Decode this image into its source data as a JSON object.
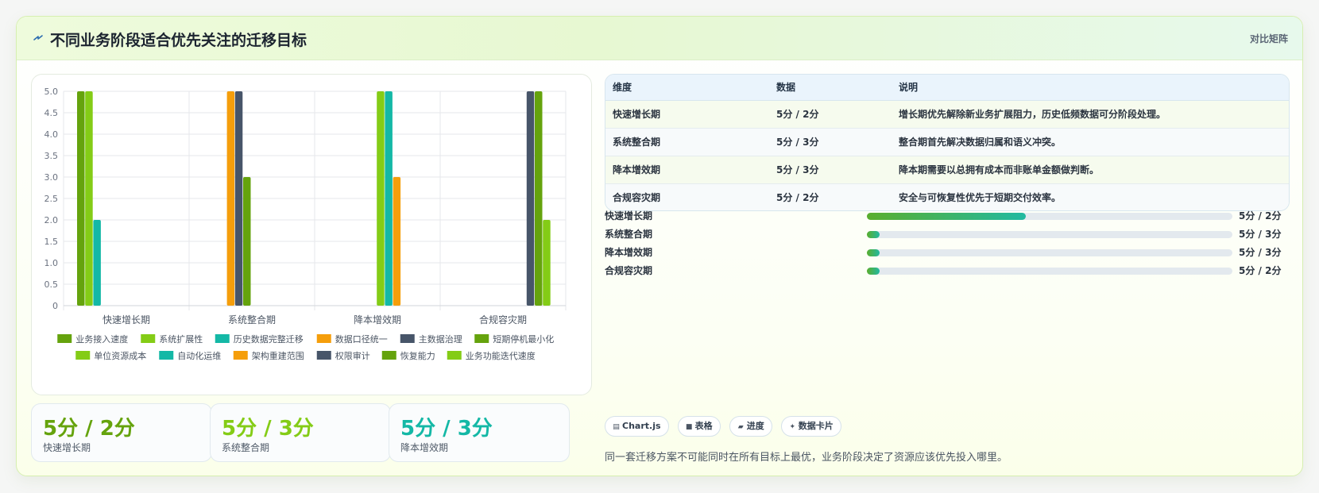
{
  "header": {
    "title": "不同业务阶段适合优先关注的迁移目标",
    "meta": "对比矩阵"
  },
  "chart_data": {
    "type": "bar",
    "categories": [
      "快速增长期",
      "系统整合期",
      "降本增效期",
      "合规容灾期"
    ],
    "ylim": [
      0,
      5
    ],
    "yticks": [
      "0",
      "0.5",
      "1.0",
      "1.5",
      "2.0",
      "2.5",
      "3.0",
      "3.5",
      "4.0",
      "4.5",
      "5.0"
    ],
    "grid": true,
    "legend_position": "bottom",
    "series": [
      {
        "name": "业务接入速度",
        "color": "#65a30d",
        "values": [
          5,
          null,
          null,
          null
        ]
      },
      {
        "name": "系统扩展性",
        "color": "#84cc16",
        "values": [
          5,
          null,
          null,
          null
        ]
      },
      {
        "name": "历史数据完整迁移",
        "color": "#14b8a6",
        "values": [
          2,
          null,
          null,
          null
        ]
      },
      {
        "name": "数据口径统一",
        "color": "#f59e0b",
        "values": [
          null,
          5,
          null,
          null
        ]
      },
      {
        "name": "主数据治理",
        "color": "#475569",
        "values": [
          null,
          5,
          null,
          null
        ]
      },
      {
        "name": "短期停机最小化",
        "color": "#65a30d",
        "values": [
          null,
          3,
          null,
          null
        ]
      },
      {
        "name": "单位资源成本",
        "color": "#84cc16",
        "values": [
          null,
          null,
          5,
          null
        ]
      },
      {
        "name": "自动化运维",
        "color": "#14b8a6",
        "values": [
          null,
          null,
          5,
          null
        ]
      },
      {
        "name": "架构重建范围",
        "color": "#f59e0b",
        "values": [
          null,
          null,
          3,
          null
        ]
      },
      {
        "name": "权限审计",
        "color": "#475569",
        "values": [
          null,
          null,
          null,
          5
        ]
      },
      {
        "name": "恢复能力",
        "color": "#65a30d",
        "values": [
          null,
          null,
          null,
          5
        ]
      },
      {
        "name": "业务功能迭代速度",
        "color": "#84cc16",
        "values": [
          null,
          null,
          null,
          2
        ]
      }
    ]
  },
  "stats": [
    {
      "value": "5分 / 2分",
      "label": "快速增长期",
      "color": "#65a30d"
    },
    {
      "value": "5分 / 3分",
      "label": "系统整合期",
      "color": "#84cc16"
    },
    {
      "value": "5分 / 3分",
      "label": "降本增效期",
      "color": "#14b8a6"
    }
  ],
  "table": {
    "headers": [
      "维度",
      "数据",
      "说明"
    ],
    "rows": [
      [
        "快速增长期",
        "5分 / 2分",
        "增长期优先解除新业务扩展阻力，历史低频数据可分阶段处理。"
      ],
      [
        "系统整合期",
        "5分 / 3分",
        "整合期首先解决数据归属和语义冲突。"
      ],
      [
        "降本增效期",
        "5分 / 3分",
        "降本期需要以总拥有成本而非账单金额做判断。"
      ],
      [
        "合规容灾期",
        "5分 / 2分",
        "安全与可恢复性优先于短期交付效率。"
      ]
    ]
  },
  "progress": [
    {
      "label": "快速增长期",
      "value": "5分 / 2分",
      "fraction": 0.435
    },
    {
      "label": "系统整合期",
      "value": "5分 / 3分",
      "fraction": 0.035
    },
    {
      "label": "降本增效期",
      "value": "5分 / 3分",
      "fraction": 0.035
    },
    {
      "label": "合规容灾期",
      "value": "5分 / 2分",
      "fraction": 0.035
    }
  ],
  "tags": [
    {
      "icon": "chart-icon",
      "glyph": "▤",
      "label": "Chart.js"
    },
    {
      "icon": "table-icon",
      "glyph": "■",
      "label": "表格"
    },
    {
      "icon": "progress-icon",
      "glyph": "▰",
      "label": "进度"
    },
    {
      "icon": "card-icon",
      "glyph": "✦",
      "label": "数据卡片"
    }
  ],
  "footnote": "同一套迁移方案不可能同时在所有目标上最优，业务阶段决定了资源应该优先投入哪里。"
}
